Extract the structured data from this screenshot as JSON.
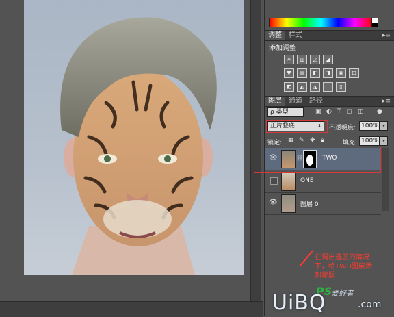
{
  "adjust_panel": {
    "tabs": [
      "调整",
      "样式"
    ],
    "title": "添加调整"
  },
  "layers_panel": {
    "tabs": [
      "图层",
      "通道",
      "路径"
    ],
    "kind_filter": "ρ 类型",
    "blend_mode": "正片叠底",
    "opacity_label": "不透明度:",
    "opacity_value": "100%",
    "lock_label": "锁定:",
    "fill_label": "填充:",
    "fill_value": "100%",
    "layers": [
      {
        "name": "TWO",
        "visible": true,
        "selected": true,
        "has_mask": true
      },
      {
        "name": "ONE",
        "visible": false,
        "selected": false,
        "has_mask": false
      },
      {
        "name": "图层 0",
        "visible": true,
        "selected": false,
        "has_mask": false
      }
    ]
  },
  "annotation": {
    "line1": "在调出选区的情况",
    "line2": "下，给TWO图层添",
    "line3": "加蒙版"
  },
  "watermark": {
    "ps": "PS",
    "cn": "爱好者",
    "uibo": "UiBQ",
    "com": ".com"
  }
}
